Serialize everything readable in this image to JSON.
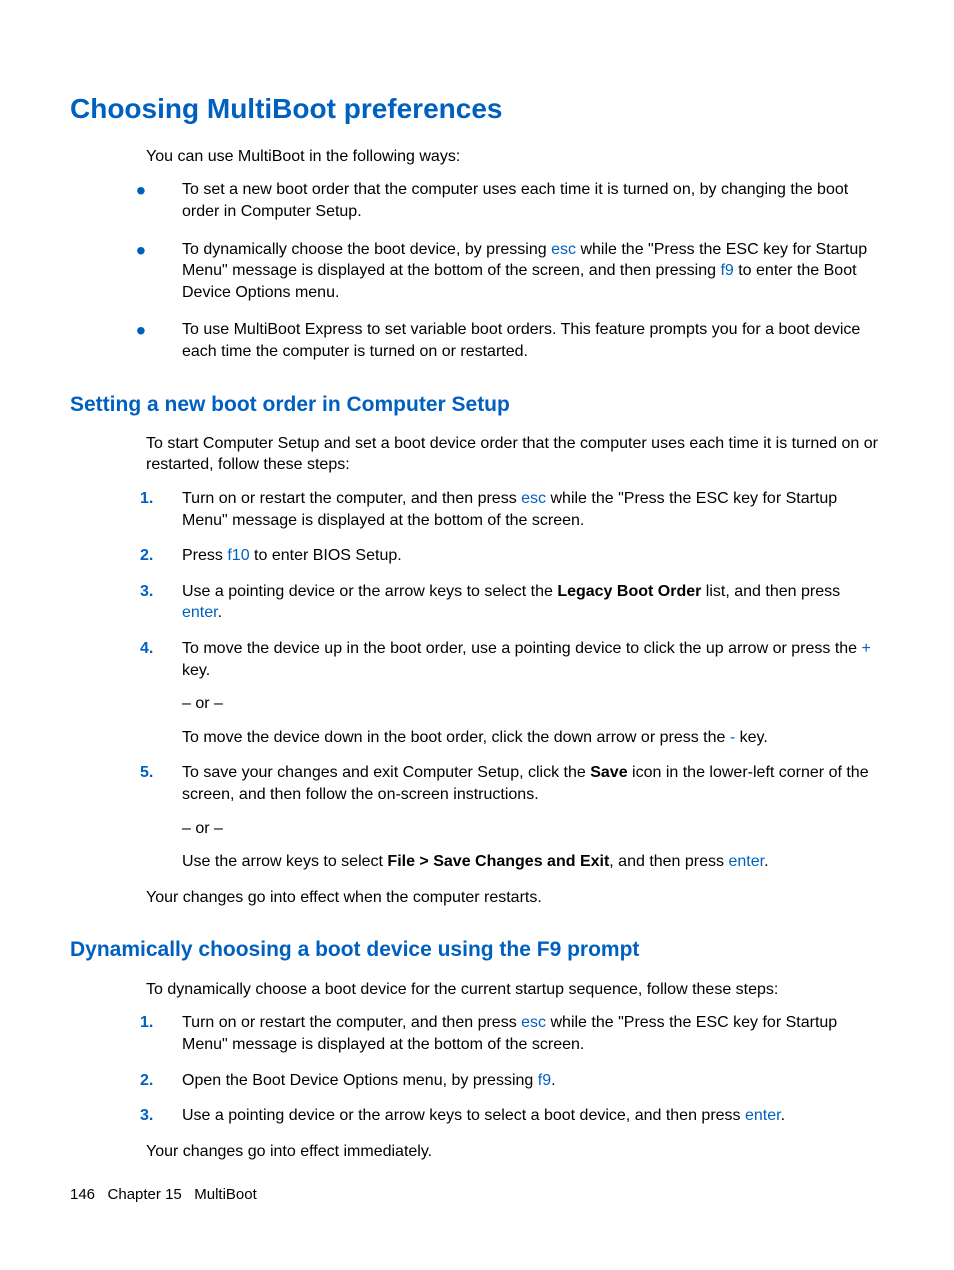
{
  "h1": "Choosing MultiBoot preferences",
  "intro": "You can use MultiBoot in the following ways:",
  "bullets": {
    "b1": "To set a new boot order that the computer uses each time it is turned on, by changing the boot order in Computer Setup.",
    "b2a": "To dynamically choose the boot device, by pressing ",
    "b2_esc": "esc",
    "b2b": " while the \"Press the ESC key for Startup Menu\" message is displayed at the bottom of the screen, and then pressing ",
    "b2_f9": "f9",
    "b2c": " to enter the Boot Device Options menu.",
    "b3": "To use MultiBoot Express to set variable boot orders. This feature prompts you for a boot device each time the computer is turned on or restarted."
  },
  "sec1_h2": "Setting a new boot order in Computer Setup",
  "sec1_intro": "To start Computer Setup and set a boot device order that the computer uses each time it is turned on or restarted, follow these steps:",
  "sec1": {
    "s1a": "Turn on or restart the computer, and then press ",
    "s1_esc": "esc",
    "s1b": " while the \"Press the ESC key for Startup Menu\" message is displayed at the bottom of the screen.",
    "s2a": "Press ",
    "s2_f10": "f10",
    "s2b": " to enter BIOS Setup.",
    "s3a": "Use a pointing device or the arrow keys to select the ",
    "s3_bold": "Legacy Boot Order",
    "s3b": " list, and then press ",
    "s3_enter": "enter",
    "s3c": ".",
    "s4a": "To move the device up in the boot order, use a pointing device to click the up arrow or press the ",
    "s4_plus": "+",
    "s4b": " key.",
    "s4_or": "– or –",
    "s4c": "To move the device down in the boot order, click the down arrow or press the ",
    "s4_minus": "-",
    "s4d": " key.",
    "s5a": "To save your changes and exit Computer Setup, click the ",
    "s5_save": "Save",
    "s5b": " icon in the lower-left corner of the screen, and then follow the on-screen instructions.",
    "s5_or": "– or –",
    "s5c": "Use the arrow keys to select ",
    "s5_bold": "File > Save Changes and Exit",
    "s5d": ", and then press ",
    "s5_enter": "enter",
    "s5e": "."
  },
  "sec1_out": "Your changes go into effect when the computer restarts.",
  "sec2_h2": "Dynamically choosing a boot device using the F9 prompt",
  "sec2_intro": "To dynamically choose a boot device for the current startup sequence, follow these steps:",
  "sec2": {
    "s1a": "Turn on or restart the computer, and then press ",
    "s1_esc": "esc",
    "s1b": " while the \"Press the ESC key for Startup Menu\" message is displayed at the bottom of the screen.",
    "s2a": "Open the Boot Device Options menu, by pressing ",
    "s2_f9": "f9",
    "s2b": ".",
    "s3a": "Use a pointing device or the arrow keys to select a boot device, and then press ",
    "s3_enter": "enter",
    "s3b": "."
  },
  "sec2_out": "Your changes go into effect immediately.",
  "footer_page": "146",
  "footer_chapter": "   Chapter 15   MultiBoot"
}
